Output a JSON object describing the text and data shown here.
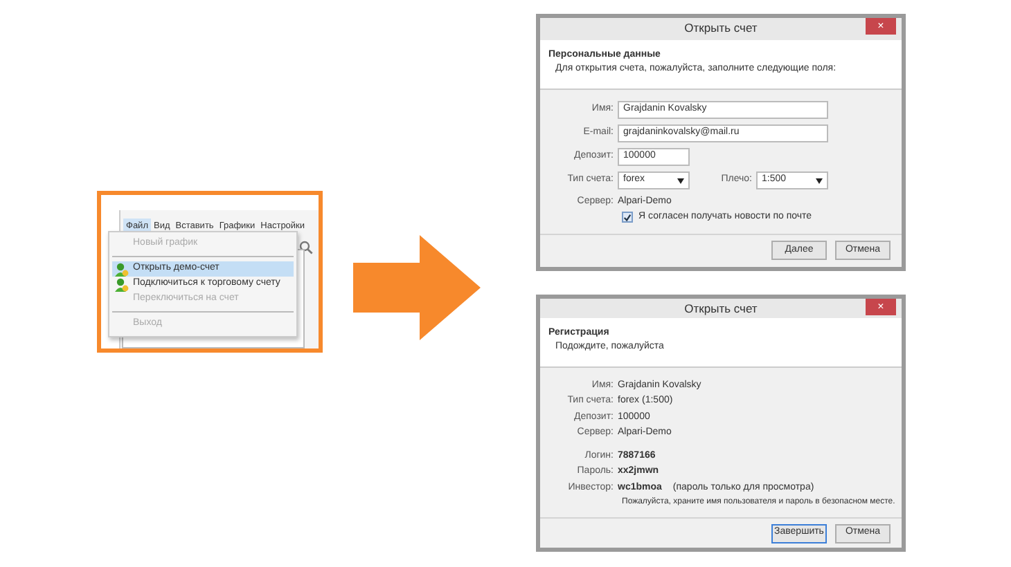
{
  "menu_window": {
    "menu_bar": [
      {
        "label": "Файл",
        "selected": true
      },
      {
        "label": "Вид",
        "selected": false
      },
      {
        "label": "Вставить",
        "selected": false
      },
      {
        "label": "Графики",
        "selected": false
      },
      {
        "label": "Настройки",
        "selected": false
      }
    ],
    "dropdown": [
      {
        "kind": "item",
        "label": "Новый график",
        "disabled": true,
        "selected": false,
        "icon": false
      },
      {
        "kind": "separator"
      },
      {
        "kind": "item",
        "label": "Открыть демо-счет",
        "disabled": false,
        "selected": true,
        "icon": true
      },
      {
        "kind": "item",
        "label": "Подключиться к торговому счету",
        "disabled": false,
        "selected": false,
        "icon": true
      },
      {
        "kind": "item",
        "label": "Переключиться на счет",
        "disabled": true,
        "selected": false,
        "icon": false
      },
      {
        "kind": "separator"
      },
      {
        "kind": "item",
        "label": "Выход",
        "disabled": true,
        "selected": false,
        "icon": false
      }
    ]
  },
  "dialogs": [
    {
      "title": "Открыть счет",
      "close": "×",
      "heading": "Персональные данные",
      "subheading": "Для открытия счета, пожалуйста, заполните следующие поля:",
      "field_groups": [
        [
          {
            "kind": "input",
            "label": "Имя:",
            "value": "Grajdanin Kovalsky",
            "wide": true
          },
          {
            "kind": "input",
            "label": "E-mail:",
            "value": "grajdaninkovalsky@mail.ru",
            "wide": true
          },
          {
            "kind": "input",
            "label": "Депозит:",
            "value": "100000",
            "wide": false
          },
          {
            "kind": "selects",
            "items": [
              {
                "label": "Тип счета:",
                "value": "forex"
              },
              {
                "label": "Плечо:",
                "value": "1:500"
              }
            ]
          },
          {
            "kind": "text",
            "label": "Сервер:",
            "value": "Alpari-Demo",
            "bold": false
          },
          {
            "kind": "checkbox",
            "label": "Я согласен получать новости по почте",
            "checked": true
          }
        ]
      ],
      "buttons": [
        {
          "label": "Далее",
          "default": false
        },
        {
          "label": "Отмена",
          "default": false
        }
      ]
    },
    {
      "title": "Открыть счет",
      "close": "×",
      "heading": "Регистрация",
      "subheading": "Подождите, пожалуйста",
      "field_groups": [
        [
          {
            "kind": "text",
            "label": "Имя:",
            "value": "Grajdanin Kovalsky",
            "bold": false
          },
          {
            "kind": "text",
            "label": "Тип счета:",
            "value": "forex (1:500)",
            "bold": false
          },
          {
            "kind": "text",
            "label": "Депозит:",
            "value": "100000",
            "bold": false
          },
          {
            "kind": "text",
            "label": "Сервер:",
            "value": "Alpari-Demo",
            "bold": false
          }
        ],
        [
          {
            "kind": "text",
            "label": "Логин:",
            "value": "7887166",
            "bold": true
          },
          {
            "kind": "text",
            "label": "Пароль:",
            "value": "xx2jmwn",
            "bold": true
          },
          {
            "kind": "text",
            "label": "Инвестор:",
            "value": "wc1bmoa",
            "bold": true,
            "note": "(пароль только для просмотра)"
          },
          {
            "kind": "note",
            "text": "Пожалуйста, храните имя пользователя и пароль в безопасном месте."
          }
        ]
      ],
      "buttons": [
        {
          "label": "Завершить",
          "default": true
        },
        {
          "label": "Отмена",
          "default": false
        }
      ]
    }
  ]
}
